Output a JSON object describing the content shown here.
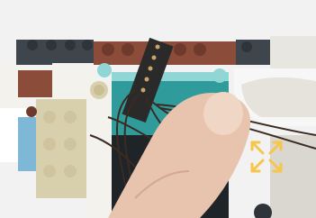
{
  "image": {
    "subject": "photo",
    "overlay_icon": "expand-arrows-icon",
    "colors": {
      "background": "#f2f2f2",
      "dark_brick": "#3f454d",
      "brown_brick": "#8b4c39",
      "teal_brick": "#2f9c9b",
      "light_teal": "#8fd6d4",
      "tan": "#d8cfad",
      "white_brick": "#f4f2ec",
      "cable_dark": "#3b2a22",
      "skin": "#e8c3ad",
      "overlay_accent": "#f6c64a"
    }
  }
}
